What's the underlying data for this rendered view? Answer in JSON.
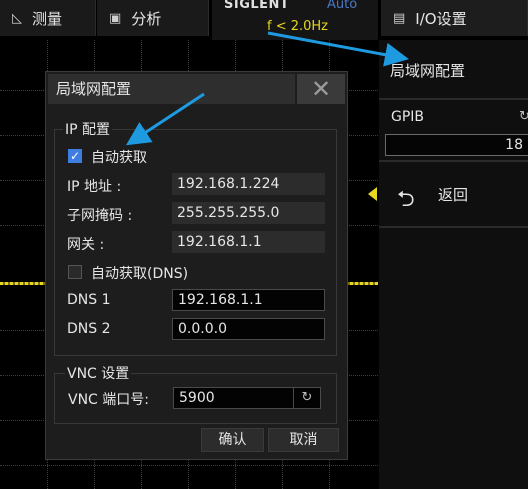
{
  "topbar": {
    "measure_label": "测量",
    "measure_icon": "ruler-icon",
    "analyze_label": "分析",
    "analyze_icon": "image-analysis-icon",
    "io_label": "I/O设置",
    "io_icon": "document-icon"
  },
  "brand": {
    "name": "SIGLENT",
    "trigger_mode": "Auto",
    "frequency": "f < 2.0Hz"
  },
  "menu": {
    "title": "局域网配置",
    "gpib_label": "GPIB",
    "gpib_value": "18",
    "back_label": "返回"
  },
  "dialog": {
    "title": "局域网配置",
    "close_glyph": "✕",
    "ip_group_title": "IP 配置",
    "auto_obtain_label": "自动获取",
    "auto_obtain_checked": true,
    "ip_label": "IP 地址 :",
    "ip_value": "192.168.1.224",
    "subnet_label": "子网掩码 :",
    "subnet_value": "255.255.255.0",
    "gateway_label": "网关 :",
    "gateway_value": "192.168.1.1",
    "auto_dns_label": "自动获取(DNS)",
    "auto_dns_checked": false,
    "dns1_label": "DNS 1",
    "dns1_value": "192.168.1.1",
    "dns2_label": "DNS 2",
    "dns2_value": "0.0.0.0",
    "vnc_group_title": "VNC 设置",
    "vnc_port_label": "VNC 端口号:",
    "vnc_port_value": "5900",
    "ok_label": "确认",
    "cancel_label": "取消"
  },
  "colors": {
    "trace": "#e8d61f",
    "accent": "#3d7ee0",
    "annotation_arrow": "#1e9be0"
  }
}
